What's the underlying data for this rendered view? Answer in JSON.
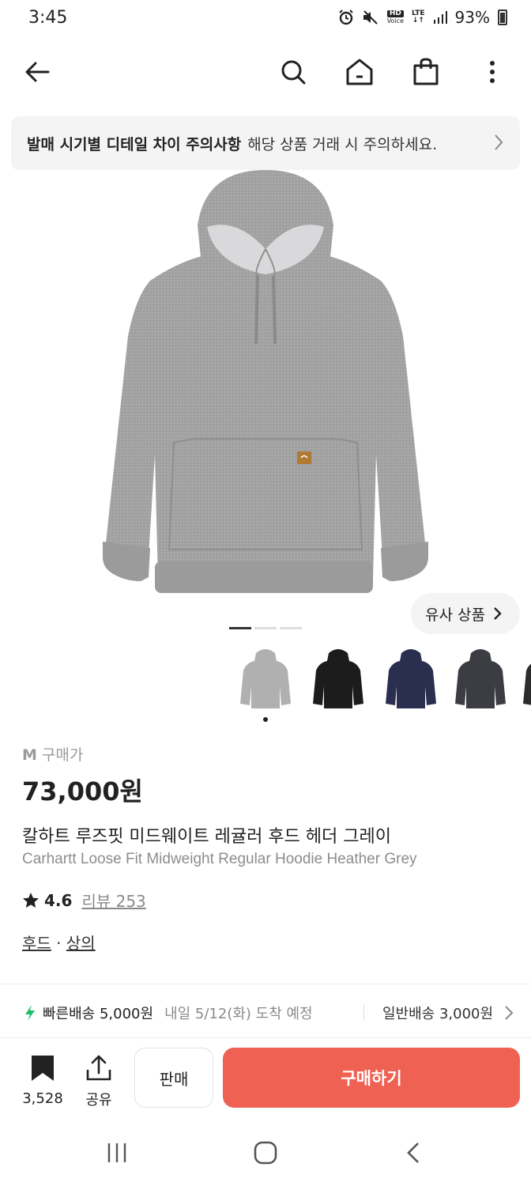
{
  "status_bar": {
    "time": "3:45",
    "hd_label": "HD",
    "voice_label": "Voice",
    "lte_label": "LTE",
    "battery": "93%",
    "icons": [
      "alarm-icon",
      "mute-icon",
      "signal-icon",
      "battery-icon"
    ]
  },
  "nav": {
    "icons": [
      "back-arrow-icon",
      "search-icon",
      "home-icon",
      "shopping-bag-icon",
      "more-vertical-icon"
    ]
  },
  "notice": {
    "title": "발매 시기별 디테일 차이 주의사항",
    "text": "해당 상품 거래 시 주의하세요."
  },
  "product": {
    "similar_label": "유사 상품",
    "image_pages": 3,
    "active_page": 1,
    "thumbnails": [
      {
        "name": "thumb-heather-grey",
        "color": "#a9a9a9"
      },
      {
        "name": "thumb-black",
        "color": "#1c1c1c"
      },
      {
        "name": "thumb-navy",
        "color": "#2a2f4f"
      },
      {
        "name": "thumb-charcoal",
        "color": "#3b3d42"
      },
      {
        "name": "thumb-partial",
        "color": "#2c2c2c"
      }
    ],
    "size": "M",
    "price_label": "구매가",
    "price": "73,000원",
    "title_ko": "칼하트 루즈핏 미드웨이트 레귤러 후드 헤더 그레이",
    "title_en": "Carhartt Loose Fit Midweight Regular Hoodie Heather Grey",
    "rating": "4.6",
    "review_label": "리뷰 253",
    "category_1": "후드",
    "category_sep": "·",
    "category_2": "상의"
  },
  "delivery": {
    "fast_label": "빠른배송 5,000원",
    "fast_date": "내일 5/12(화) 도착 예정",
    "normal_label": "일반배송 3,000원"
  },
  "actions": {
    "bookmark_count": "3,528",
    "share_label": "공유",
    "sell_label": "판매",
    "buy_label": "구매하기"
  },
  "colors": {
    "buy_button": "#ef6253",
    "fast_delivery_icon": "#1fbf6b",
    "banner_bg": "#f4f4f5"
  }
}
